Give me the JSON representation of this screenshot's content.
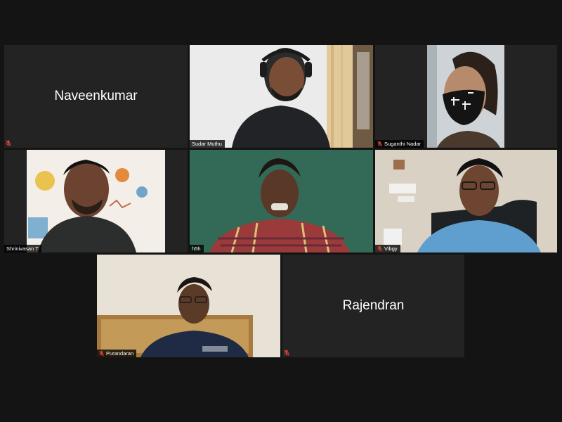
{
  "participants": [
    {
      "id": "naveenkumar",
      "name": "Naveenkumar",
      "video": false,
      "muted": true
    },
    {
      "id": "sudar",
      "name": "Sudar Muthu",
      "video": true,
      "muted": false
    },
    {
      "id": "suganthi",
      "name": "Suganthi Nadar",
      "video": true,
      "muted": true
    },
    {
      "id": "shrinivasan",
      "name": "Shrinivasan T",
      "video": true,
      "muted": false
    },
    {
      "id": "h5h",
      "name": "h5h",
      "video": true,
      "muted": false,
      "active_speaker": true
    },
    {
      "id": "vibgy",
      "name": "Vibgy",
      "video": true,
      "muted": true
    },
    {
      "id": "purandaran",
      "name": "Purandaran",
      "video": true,
      "muted": true
    },
    {
      "id": "rajendran",
      "name": "Rajendran",
      "video": false,
      "muted": true
    }
  ],
  "colors": {
    "background": "#141414",
    "tile": "#232323",
    "active_border": "#c8d88a",
    "mute_icon": "#e0443c"
  }
}
